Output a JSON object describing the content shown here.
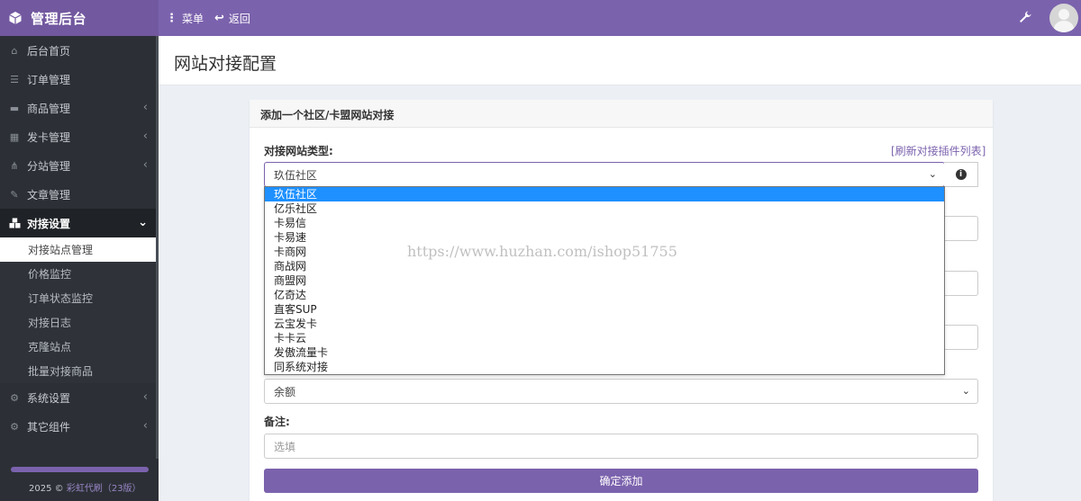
{
  "header": {
    "brand_title": "管理后台",
    "nav": [
      {
        "icon": "menu-dots-icon",
        "label": "菜单"
      },
      {
        "icon": "back-arrow-icon",
        "label": "返回"
      }
    ],
    "accent_color": "#7b62ad"
  },
  "sidebar": {
    "items": [
      {
        "label": "后台首页",
        "icon": "home-icon"
      },
      {
        "label": "订单管理",
        "icon": "list-icon"
      },
      {
        "label": "商品管理",
        "icon": "cart-icon",
        "chevron": "‹"
      },
      {
        "label": "发卡管理",
        "icon": "grid-icon",
        "chevron": "‹"
      },
      {
        "label": "分站管理",
        "icon": "sitemap-icon",
        "chevron": "‹"
      },
      {
        "label": "文章管理",
        "icon": "edit-icon"
      },
      {
        "label": "对接设置",
        "icon": "cubes-icon",
        "chevron": "⌄"
      }
    ],
    "subitems": [
      "对接站点管理",
      "价格监控",
      "订单状态监控",
      "对接日志",
      "克隆站点",
      "批量对接商品"
    ],
    "items_after": [
      {
        "label": "系统设置",
        "icon": "gear-icon",
        "chevron": "‹"
      },
      {
        "label": "其它组件",
        "icon": "cogs-icon",
        "chevron": "‹"
      }
    ],
    "footer": {
      "year": "2025 ©",
      "name": "彩虹代刷（23版）"
    }
  },
  "page": {
    "title": "网站对接配置",
    "panel_title": "添加一个社区/卡盟网站对接",
    "site_type_label": "对接网站类型:",
    "refresh_link": "[刷新对接插件列表]",
    "site_type_value": "玖伍社区",
    "dropdown_options": [
      "玖伍社区",
      "亿乐社区",
      "卡易信",
      "卡易速",
      "卡商网",
      "商战网",
      "商盟网",
      "亿奇达",
      "直客SUP",
      "云宝发卡",
      "卡卡云",
      "发傲流量卡",
      "同系统对接"
    ],
    "selected_index": 0,
    "balance_value": "余额",
    "remark_label": "备注:",
    "remark_placeholder": "选填",
    "submit_label": "确定添加"
  },
  "watermark": "https://www.huzhan.com/ishop51755"
}
